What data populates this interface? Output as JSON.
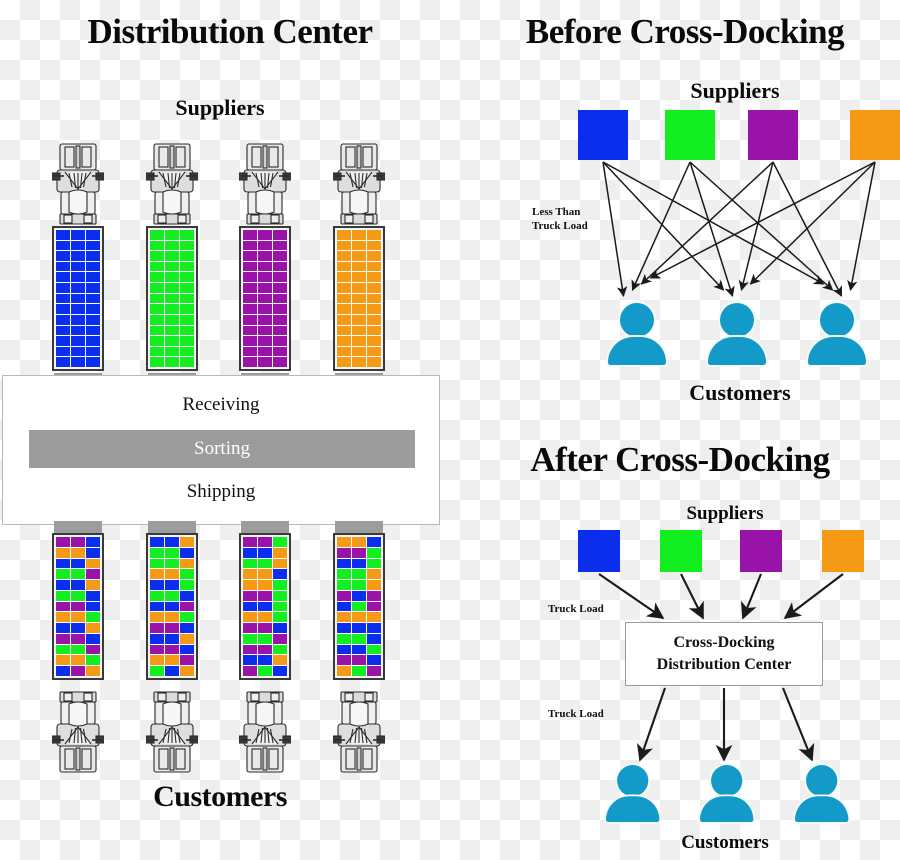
{
  "left_panel": {
    "title": "Distribution Center",
    "suppliers_label": "Suppliers",
    "customers_label": "Customers",
    "dc_box": {
      "receiving": "Receiving",
      "sorting": "Sorting",
      "shipping": "Shipping"
    }
  },
  "before_panel": {
    "title": "Before Cross-Docking",
    "suppliers_label": "Suppliers",
    "customers_label": "Customers",
    "flow_label": "Less Than\nTruck Load",
    "flow_label_line1": "Less Than",
    "flow_label_line2": "Truck Load"
  },
  "after_panel": {
    "title": "After Cross-Docking",
    "suppliers_label": "Suppliers",
    "customers_label": "Customers",
    "inbound_label": "Truck Load",
    "outbound_label": "Truck Load",
    "hub_line1": "Cross-Docking",
    "hub_line2": "Distribution Center"
  },
  "colors": {
    "blue": "#0B2DEE",
    "green": "#12EE1F",
    "purple": "#9A13A8",
    "orange": "#F59A15",
    "person": "#139AC8",
    "gray_bar": "#9C9C9C",
    "dock_pad": "#9C9C9C",
    "arrow": "#1a1a1a",
    "box_bg": "#FFFFFF",
    "text": "#0A0A0A"
  },
  "supplier_colors": [
    "blue",
    "green",
    "purple",
    "orange"
  ],
  "inbound_trucks": [
    {
      "color": "blue",
      "rows": 13,
      "cols": 3
    },
    {
      "color": "green",
      "rows": 13,
      "cols": 3
    },
    {
      "color": "purple",
      "rows": 13,
      "cols": 3
    },
    {
      "color": "orange",
      "rows": 13,
      "cols": 3
    }
  ],
  "outbound_trucks": [
    {
      "grid": [
        [
          "purple",
          "purple",
          "blue"
        ],
        [
          "orange",
          "orange",
          "blue"
        ],
        [
          "blue",
          "blue",
          "orange"
        ],
        [
          "green",
          "green",
          "purple"
        ],
        [
          "blue",
          "blue",
          "orange"
        ],
        [
          "green",
          "green",
          "blue"
        ],
        [
          "purple",
          "purple",
          "blue"
        ],
        [
          "orange",
          "orange",
          "green"
        ],
        [
          "blue",
          "blue",
          "orange"
        ],
        [
          "purple",
          "purple",
          "blue"
        ],
        [
          "green",
          "green",
          "purple"
        ],
        [
          "orange",
          "orange",
          "green"
        ],
        [
          "blue",
          "purple",
          "orange"
        ]
      ]
    },
    {
      "grid": [
        [
          "blue",
          "blue",
          "orange"
        ],
        [
          "green",
          "green",
          "blue"
        ],
        [
          "green",
          "green",
          "orange"
        ],
        [
          "orange",
          "orange",
          "green"
        ],
        [
          "blue",
          "blue",
          "green"
        ],
        [
          "green",
          "green",
          "blue"
        ],
        [
          "blue",
          "blue",
          "purple"
        ],
        [
          "orange",
          "orange",
          "green"
        ],
        [
          "purple",
          "purple",
          "blue"
        ],
        [
          "blue",
          "blue",
          "orange"
        ],
        [
          "purple",
          "purple",
          "blue"
        ],
        [
          "orange",
          "orange",
          "purple"
        ],
        [
          "green",
          "blue",
          "orange"
        ]
      ]
    },
    {
      "grid": [
        [
          "purple",
          "purple",
          "green"
        ],
        [
          "blue",
          "blue",
          "orange"
        ],
        [
          "green",
          "green",
          "orange"
        ],
        [
          "orange",
          "orange",
          "blue"
        ],
        [
          "orange",
          "orange",
          "green"
        ],
        [
          "purple",
          "purple",
          "green"
        ],
        [
          "blue",
          "blue",
          "green"
        ],
        [
          "orange",
          "orange",
          "green"
        ],
        [
          "purple",
          "purple",
          "blue"
        ],
        [
          "green",
          "green",
          "purple"
        ],
        [
          "purple",
          "purple",
          "green"
        ],
        [
          "blue",
          "blue",
          "orange"
        ],
        [
          "purple",
          "green",
          "blue"
        ]
      ]
    },
    {
      "grid": [
        [
          "orange",
          "orange",
          "blue"
        ],
        [
          "purple",
          "purple",
          "green"
        ],
        [
          "blue",
          "blue",
          "green"
        ],
        [
          "green",
          "green",
          "orange"
        ],
        [
          "green",
          "green",
          "orange"
        ],
        [
          "purple",
          "blue",
          "purple"
        ],
        [
          "blue",
          "green",
          "purple"
        ],
        [
          "orange",
          "orange",
          "orange"
        ],
        [
          "blue",
          "blue",
          "blue"
        ],
        [
          "green",
          "green",
          "blue"
        ],
        [
          "blue",
          "blue",
          "green"
        ],
        [
          "purple",
          "purple",
          "blue"
        ],
        [
          "orange",
          "green",
          "purple"
        ]
      ]
    }
  ]
}
